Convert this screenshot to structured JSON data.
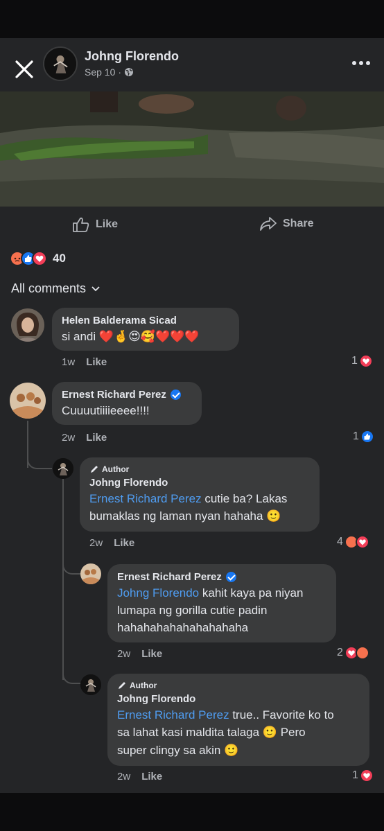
{
  "post": {
    "author": "Johng Florendo",
    "date": "Sep 10",
    "date_separator": "·"
  },
  "actions": {
    "like": "Like",
    "share": "Share"
  },
  "reactions": {
    "count": "40",
    "icons": [
      "angry",
      "like",
      "love"
    ]
  },
  "comments_sort": "All comments",
  "comments": [
    {
      "name": "Helen Balderama Sicad",
      "text": "si andi",
      "emoji": "❤️🤞😍🥰❤️❤️❤️",
      "time": "1w",
      "like": "Like",
      "reaction_count": "1",
      "reaction_icons": [
        "love"
      ]
    },
    {
      "name": "Ernest Richard Perez",
      "verified": true,
      "text": "Cuuuutiiiieeee!!!!",
      "time": "2w",
      "like": "Like",
      "reaction_count": "1",
      "reaction_icons": [
        "like"
      ],
      "replies": [
        {
          "author_tag": "Author",
          "name": "Johng Florendo",
          "mention": "Ernest Richard Perez",
          "text_line1": "cutie ba? Lakas",
          "text_line2": "bumaklas ng laman nyan hahaha",
          "emoji": "🙂",
          "time": "2w",
          "like": "Like",
          "reaction_count": "4",
          "reaction_icons": [
            "angry",
            "love"
          ]
        },
        {
          "name": "Ernest Richard Perez",
          "verified": true,
          "mention": "Johng Florendo",
          "text_line1": "kahit kaya pa niyan",
          "text_line2": "lumapa ng gorilla cutie padin",
          "text_line3": "hahahahahahahahahaha",
          "time": "2w",
          "like": "Like",
          "reaction_count": "2",
          "reaction_icons": [
            "love",
            "angry"
          ]
        },
        {
          "author_tag": "Author",
          "name": "Johng Florendo",
          "mention": "Ernest Richard Perez",
          "text_line1": "true.. Favorite ko to",
          "text_line2": "sa lahat kasi maldita talaga",
          "text_line2_emoji": "🙂",
          "text_line2b": "Pero",
          "text_line3": "super clingy sa akin",
          "text_line3_emoji": "🙂",
          "time": "2w",
          "like": "Like",
          "reaction_count": "1",
          "reaction_icons": [
            "love"
          ]
        }
      ]
    }
  ],
  "colors": {
    "background": "#242527",
    "bubble": "#3a3b3c",
    "mention": "#4f9cf0",
    "like_blue": "#1877f2",
    "love_red": "#f33e58",
    "angry_orange": "#f7714e"
  }
}
